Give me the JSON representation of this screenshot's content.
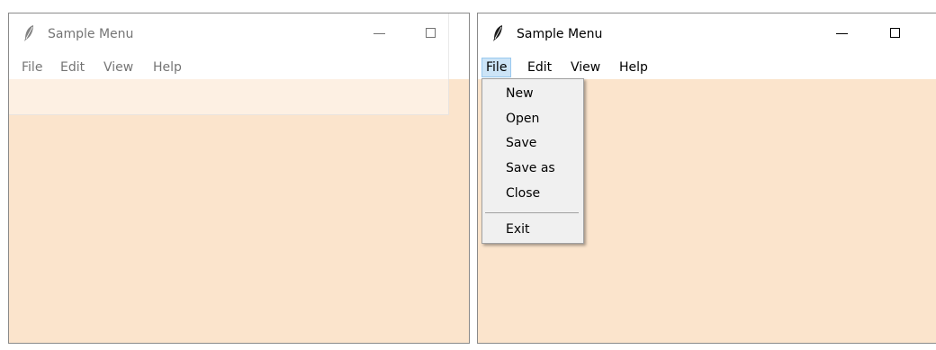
{
  "left_window": {
    "title": "Sample Menu",
    "menus": [
      "File",
      "Edit",
      "View",
      "Help"
    ]
  },
  "right_window": {
    "title": "Sample Menu",
    "menus": [
      "File",
      "Edit",
      "View",
      "Help"
    ],
    "active_menu": "File",
    "file_menu_items": [
      "New",
      "Open",
      "Save",
      "Save as",
      "Close"
    ],
    "exit_label": "Exit"
  },
  "icons": {
    "app_icon": "feather-icon",
    "minimize": "minimize-icon",
    "maximize": "maximize-icon"
  },
  "colors": {
    "client_area": "#fbe4cc",
    "active_menu_bg": "#cce4f7",
    "dropdown_bg": "#f0f0f0"
  }
}
